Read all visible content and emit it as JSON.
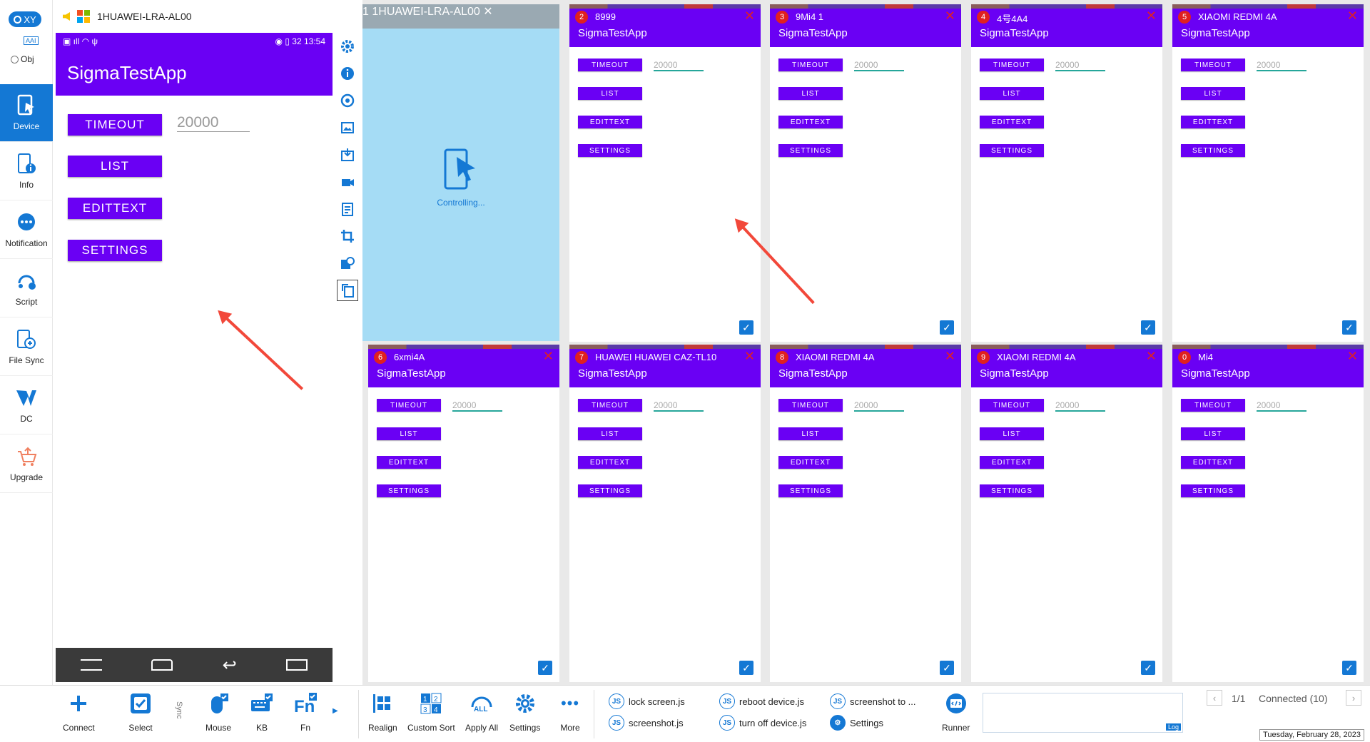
{
  "left": {
    "mode_label": "XY",
    "aai": "AAI",
    "obj": "Obj",
    "nav": [
      {
        "label": "Device",
        "icon": "device-icon"
      },
      {
        "label": "Info",
        "icon": "info-icon"
      },
      {
        "label": "Notification",
        "icon": "notification-icon"
      },
      {
        "label": "Script",
        "icon": "script-icon"
      },
      {
        "label": "File Sync",
        "icon": "file-sync-icon"
      },
      {
        "label": "DC",
        "icon": "dc-icon"
      },
      {
        "label": "Upgrade",
        "icon": "upgrade-icon"
      }
    ]
  },
  "phone": {
    "title": "1HUAWEI-LRA-AL00",
    "time": "13:54",
    "battery": "32",
    "app": "SigmaTestApp",
    "buttons": [
      "TIMEOUT",
      "LIST",
      "EDITTEXT",
      "SETTINGS"
    ],
    "timeout_value": "20000"
  },
  "controlling": {
    "num": "1",
    "name": "1HUAWEI-LRA-AL00",
    "text": "Controlling..."
  },
  "tiles": [
    {
      "num": "2",
      "name": "8999"
    },
    {
      "num": "3",
      "name": "9Mi4 1"
    },
    {
      "num": "4",
      "name": "4号4A4"
    },
    {
      "num": "5",
      "name": "XIAOMI REDMI 4A"
    },
    {
      "num": "6",
      "name": "6xmi4A"
    },
    {
      "num": "7",
      "name": "HUAWEI HUAWEI CAZ-TL10"
    },
    {
      "num": "8",
      "name": "XIAOMI REDMI 4A"
    },
    {
      "num": "9",
      "name": "XIAOMI REDMI 4A"
    },
    {
      "num": "0",
      "name": "Mi4"
    }
  ],
  "tile_app": "SigmaTestApp",
  "tile_buttons": [
    "TIMEOUT",
    "LIST",
    "EDITTEXT",
    "SETTINGS"
  ],
  "tile_value": "20000",
  "bottom": {
    "tools": [
      "Connect",
      "Select",
      "Mouse",
      "KB",
      "Fn"
    ],
    "sync": "Sync",
    "tools2": [
      "Realign",
      "Custom Sort",
      "Apply All",
      "Settings",
      "More"
    ],
    "scripts": [
      "lock screen.js",
      "screenshot.js",
      "reboot device.js",
      "turn off device.js",
      "screenshot to ...",
      "Settings"
    ],
    "runner": "Runner",
    "log": "Log",
    "page": "1/1",
    "connected": "Connected (10)",
    "date": "Tuesday, February 28, 2023"
  },
  "colors": {
    "accent": "#1478d4",
    "app": "#6a00f4",
    "close": "#e02020"
  }
}
